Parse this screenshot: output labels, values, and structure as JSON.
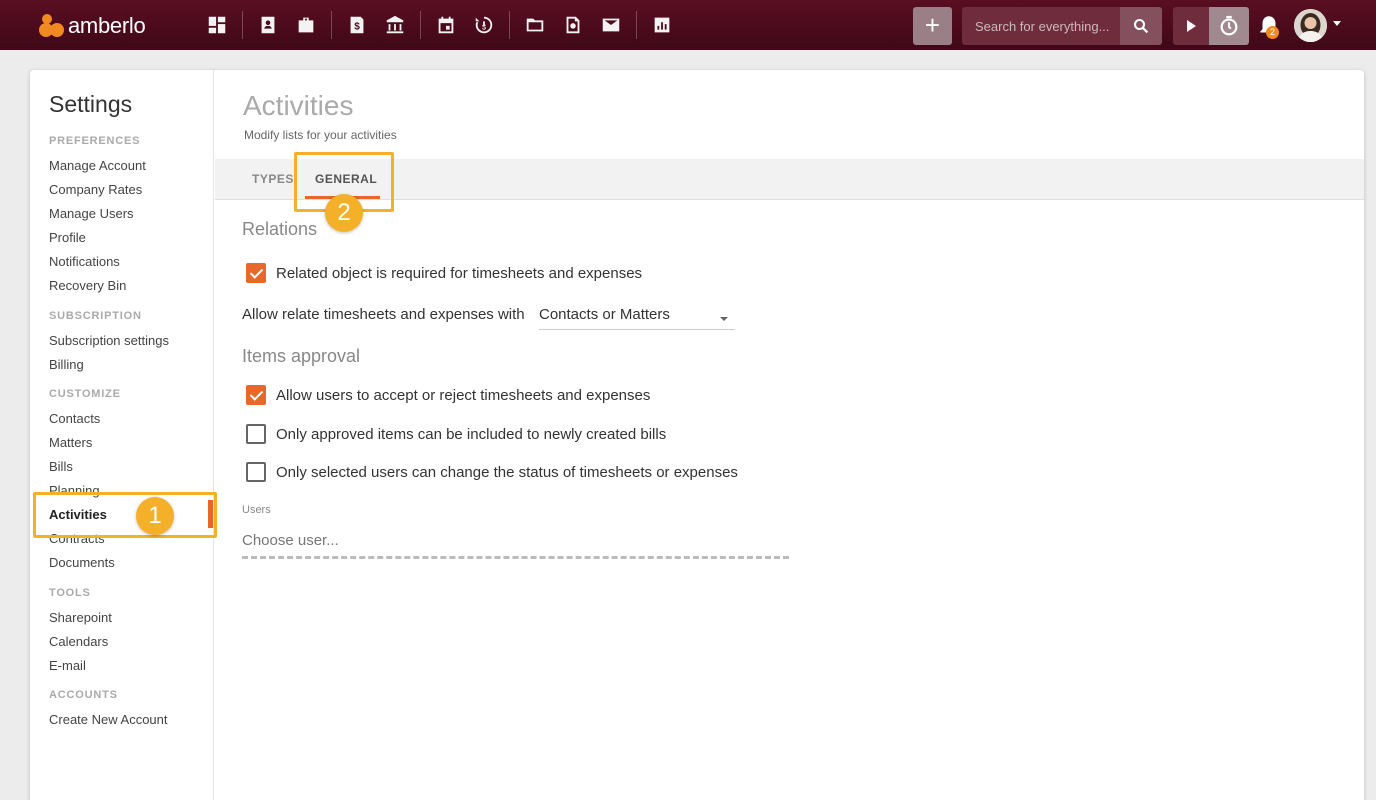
{
  "app": {
    "logo_text": "amberlo",
    "search_placeholder": "Search for everything...",
    "notification_count": "2",
    "nav_icons": [
      "dashboard-icon",
      "contacts-icon",
      "matters-icon",
      "bills-icon",
      "bank-icon",
      "calendar-icon",
      "timesheet-icon",
      "folder-icon",
      "document-search-icon",
      "mail-icon",
      "reports-icon"
    ]
  },
  "sidebar": {
    "title": "Settings",
    "sections": [
      {
        "label": "PREFERENCES",
        "items": [
          "Manage Account",
          "Company Rates",
          "Manage Users",
          "Profile",
          "Notifications",
          "Recovery Bin"
        ]
      },
      {
        "label": "SUBSCRIPTION",
        "items": [
          "Subscription settings",
          "Billing"
        ]
      },
      {
        "label": "CUSTOMIZE",
        "items": [
          "Contacts",
          "Matters",
          "Bills",
          "Planning",
          "Activities",
          "Contracts",
          "Documents"
        ]
      },
      {
        "label": "TOOLS",
        "items": [
          "Sharepoint",
          "Calendars",
          "E-mail"
        ]
      },
      {
        "label": "ACCOUNTS",
        "items": [
          "Create New Account"
        ]
      }
    ],
    "active_item": "Activities"
  },
  "page": {
    "title": "Activities",
    "subtitle": "Modify lists for your activities",
    "tabs": [
      "TYPES",
      "GENERAL"
    ],
    "active_tab": "GENERAL",
    "relations": {
      "title": "Relations",
      "related_required_label": "Related object is required for timesheets and expenses",
      "related_required_checked": true,
      "allow_relate_label": "Allow relate timesheets and expenses with",
      "allow_relate_value": "Contacts or Matters"
    },
    "approval": {
      "title": "Items approval",
      "options": [
        {
          "label": "Allow users to accept or reject timesheets and expenses",
          "checked": true
        },
        {
          "label": "Only approved items can be included to newly created bills",
          "checked": false
        },
        {
          "label": "Only selected users can change the status of timesheets or expenses",
          "checked": false
        }
      ],
      "users_label": "Users",
      "users_placeholder": "Choose user..."
    }
  },
  "annotations": [
    "1",
    "2"
  ],
  "colors": {
    "topbar": "#4a0b1c",
    "accent": "#e8672a",
    "highlight": "#f5b029"
  }
}
